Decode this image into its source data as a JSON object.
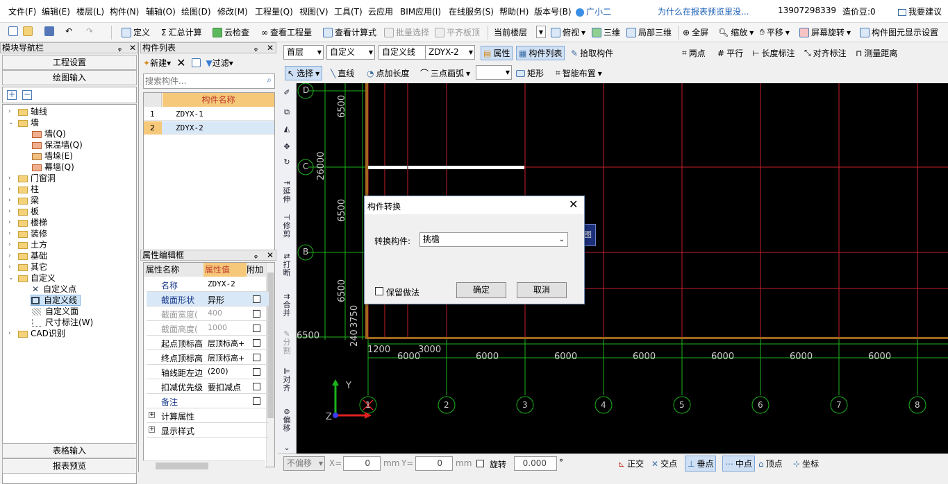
{
  "menu": [
    "文件(F)",
    "编辑(E)",
    "楼层(L)",
    "构件(N)",
    "辅轴(O)",
    "绘图(D)",
    "修改(M)",
    "工程量(Q)",
    "视图(V)",
    "工具(T)",
    "云应用",
    "BIM应用(I)",
    "在线服务(S)",
    "帮助(H)",
    "版本号(B)",
    "广小二"
  ],
  "header_right": {
    "question": "为什么在报表预览里没...",
    "phone": "13907298339",
    "beans": "造价豆:0",
    "suggest": "我要建议"
  },
  "toolbar1": {
    "define": "定义",
    "sum": "汇总计算",
    "cloud_check": "云检查",
    "view_qty": "查看工程量",
    "view_formula": "查看计算式",
    "batch_select": "批量选择",
    "align_slab": "平齐板顶",
    "floor_label": "当前楼层",
    "top_view": "俯视",
    "three_d": "三维",
    "local_3d": "局部三维",
    "fullscreen": "全屏",
    "zoom": "缩放",
    "pan": "平移",
    "rotate": "屏幕旋转",
    "show_setting": "构件图元显示设置"
  },
  "nav": {
    "title": "模块导航栏",
    "project_settings": "工程设置",
    "drawing_input": "绘图输入",
    "table_input": "表格输入",
    "report_preview": "报表预览",
    "tree": [
      "轴线",
      "墙",
      "墙(Q)",
      "保温墙(Q)",
      "墙垛(E)",
      "幕墙(Q)",
      "门窗洞",
      "柱",
      "梁",
      "板",
      "楼梯",
      "装修",
      "土方",
      "基础",
      "其它",
      "自定义",
      "自定义点",
      "自定义线",
      "自定义面",
      "尺寸标注(W)",
      "CAD识别"
    ]
  },
  "comp": {
    "title": "构件列表",
    "new": "新建",
    "filter": "过滤",
    "search_placeholder": "搜索构件...",
    "col_name": "构件名称",
    "rows": [
      {
        "n": "1",
        "name": "ZDYX-1"
      },
      {
        "n": "2",
        "name": "ZDYX-2"
      }
    ]
  },
  "prop": {
    "title": "属性编辑框",
    "col_name": "属性名称",
    "col_value": "属性值",
    "col_extra": "附加",
    "rows": [
      {
        "name": "名称",
        "value": "ZDYX-2"
      },
      {
        "name": "截面形状",
        "value": "异形"
      },
      {
        "name": "截面宽度(",
        "value": "400"
      },
      {
        "name": "截面高度(",
        "value": "1000"
      },
      {
        "name": "起点顶标高",
        "value": "层顶标高+"
      },
      {
        "name": "终点顶标高",
        "value": "层顶标高+"
      },
      {
        "name": "轴线距左边",
        "value": "(200)"
      },
      {
        "name": "扣减优先级",
        "value": "要扣减点"
      },
      {
        "name": "备注",
        "value": ""
      }
    ],
    "calc": "计算属性",
    "display": "显示样式"
  },
  "cad": {
    "floor": "首层",
    "type": "自定义",
    "subtype": "自定义线",
    "comp": "ZDYX-2",
    "attr": "属性",
    "comp_list": "构件列表",
    "pick": "拾取构件",
    "two_point": "两点",
    "parallel": "平行",
    "len_mark": "长度标注",
    "align_mark": "对齐标注",
    "measure": "测量距离",
    "select": "选择",
    "line": "直线",
    "add_len": "点加长度",
    "arc": "三点画弧",
    "rect": "矩形",
    "smart": "智能布置"
  },
  "vtool": [
    "延伸",
    "修剪",
    "打断",
    "合并",
    "分割",
    "对齐",
    "偏移"
  ],
  "axes": {
    "bottom": [
      "1",
      "2",
      "3",
      "4",
      "5",
      "6",
      "7",
      "8"
    ],
    "left": [
      "D",
      "C",
      "B"
    ],
    "spans": [
      "6000",
      "6000",
      "6000",
      "6000",
      "6000",
      "6000",
      "6000"
    ],
    "v_dims": [
      "6500",
      "26000",
      "6500",
      "6500",
      "3750",
      "240"
    ],
    "small": [
      "1200",
      "3000"
    ],
    "left_edge": "6500"
  },
  "status": {
    "offset": "不偏移",
    "x_label": "X=",
    "x": "0",
    "y_label": "Y=",
    "y": "0",
    "mm": "mm",
    "rotate": "旋转",
    "angle": "0.000",
    "deg": "°",
    "ortho": "正交",
    "intersect": "交点",
    "perp": "垂点",
    "mid": "中点",
    "vertex": "顶点",
    "coord": "坐标"
  },
  "dialog": {
    "title": "构件转换",
    "label": "转换构件:",
    "value": "挑檐",
    "keep": "保留做法",
    "ok": "确定",
    "cancel": "取消"
  },
  "colors": {
    "grid_red": "#c8202c",
    "axis_green": "#1db31d",
    "orange": "#a0641e"
  }
}
